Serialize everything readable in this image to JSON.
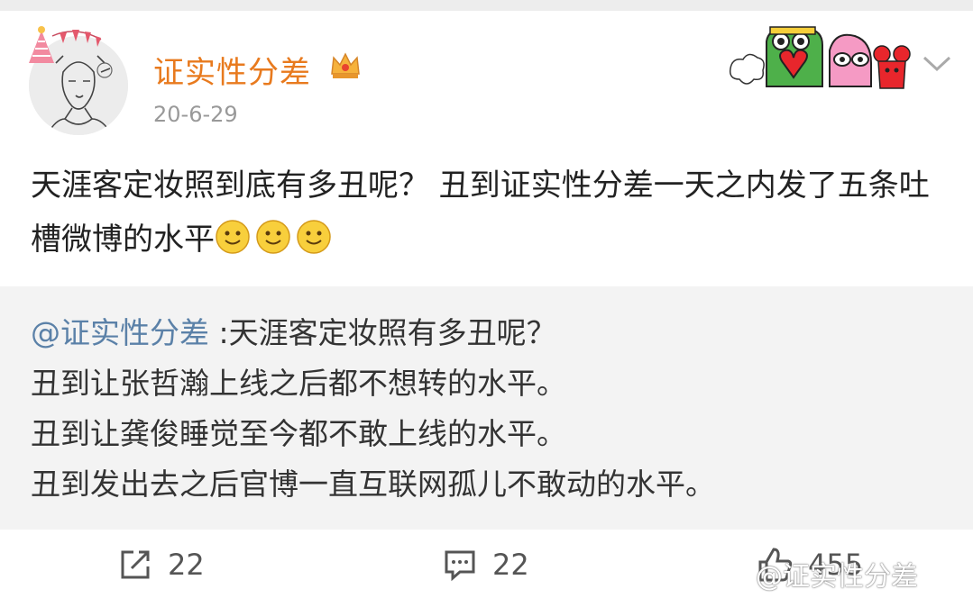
{
  "post": {
    "username": "证实性分差",
    "date": "20-6-29",
    "text": "天涯客定妆照到底有多丑呢？ 丑到证实性分差一天之内发了五条吐槽微博的水平",
    "emojis": [
      "smile-emoji",
      "smile-emoji",
      "smile-emoji"
    ]
  },
  "repost": {
    "mention": "@证实性分差",
    "lines": [
      " :天涯客定妆照有多丑呢？",
      "丑到让张哲瀚上线之后都不想转的水平。",
      "丑到让龚俊睡觉至今都不敢上线的水平。",
      "丑到发出去之后官博一直互联网孤儿不敢动的水平。"
    ]
  },
  "actions": {
    "share_count": "22",
    "comment_count": "22",
    "like_count": "455"
  },
  "watermark": "@证实性分差",
  "colors": {
    "username": "#e87a1e",
    "mention": "#5b81a8",
    "repost_bg": "#f3f3f3",
    "secondary_text": "#999999"
  },
  "icons": [
    "party-hat-icon",
    "crown-badge-icon",
    "cartoon-stickers-icon",
    "chevron-down-icon",
    "share-icon",
    "comment-icon",
    "like-icon"
  ]
}
